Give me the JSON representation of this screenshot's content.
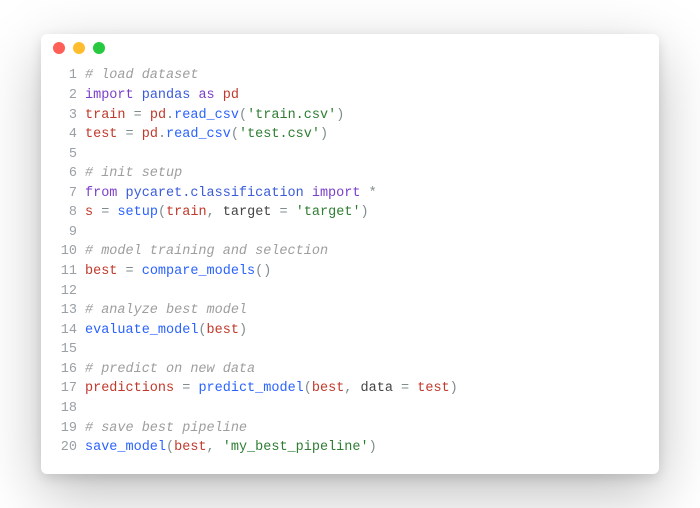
{
  "window": {
    "controls": [
      "close",
      "minimize",
      "zoom"
    ]
  },
  "code": {
    "lines": [
      {
        "n": "1",
        "tokens": [
          {
            "t": "# load dataset",
            "c": "comment"
          }
        ]
      },
      {
        "n": "2",
        "tokens": [
          {
            "t": "import",
            "c": "keyword"
          },
          {
            "t": " ",
            "c": "op"
          },
          {
            "t": "pandas",
            "c": "module"
          },
          {
            "t": " ",
            "c": "op"
          },
          {
            "t": "as",
            "c": "keyword"
          },
          {
            "t": " ",
            "c": "op"
          },
          {
            "t": "pd",
            "c": "ident"
          }
        ]
      },
      {
        "n": "3",
        "tokens": [
          {
            "t": "train",
            "c": "ident"
          },
          {
            "t": " ",
            "c": "op"
          },
          {
            "t": "=",
            "c": "op"
          },
          {
            "t": " ",
            "c": "op"
          },
          {
            "t": "pd",
            "c": "ident"
          },
          {
            "t": ".",
            "c": "op"
          },
          {
            "t": "read_csv",
            "c": "attr"
          },
          {
            "t": "(",
            "c": "op"
          },
          {
            "t": "'train.csv'",
            "c": "string"
          },
          {
            "t": ")",
            "c": "op"
          }
        ]
      },
      {
        "n": "4",
        "tokens": [
          {
            "t": "test",
            "c": "ident"
          },
          {
            "t": " ",
            "c": "op"
          },
          {
            "t": "=",
            "c": "op"
          },
          {
            "t": " ",
            "c": "op"
          },
          {
            "t": "pd",
            "c": "ident"
          },
          {
            "t": ".",
            "c": "op"
          },
          {
            "t": "read_csv",
            "c": "attr"
          },
          {
            "t": "(",
            "c": "op"
          },
          {
            "t": "'test.csv'",
            "c": "string"
          },
          {
            "t": ")",
            "c": "op"
          }
        ]
      },
      {
        "n": "5",
        "tokens": [
          {
            "t": "",
            "c": "op"
          }
        ]
      },
      {
        "n": "6",
        "tokens": [
          {
            "t": "# init setup",
            "c": "comment"
          }
        ]
      },
      {
        "n": "7",
        "tokens": [
          {
            "t": "from",
            "c": "keyword"
          },
          {
            "t": " ",
            "c": "op"
          },
          {
            "t": "pycaret.classification",
            "c": "module"
          },
          {
            "t": " ",
            "c": "op"
          },
          {
            "t": "import",
            "c": "keyword"
          },
          {
            "t": " ",
            "c": "op"
          },
          {
            "t": "*",
            "c": "op"
          }
        ]
      },
      {
        "n": "8",
        "tokens": [
          {
            "t": "s",
            "c": "ident"
          },
          {
            "t": " ",
            "c": "op"
          },
          {
            "t": "=",
            "c": "op"
          },
          {
            "t": " ",
            "c": "op"
          },
          {
            "t": "setup",
            "c": "attr"
          },
          {
            "t": "(",
            "c": "op"
          },
          {
            "t": "train",
            "c": "ident"
          },
          {
            "t": ",",
            "c": "op"
          },
          {
            "t": " ",
            "c": "op"
          },
          {
            "t": "target",
            "c": "kwarg"
          },
          {
            "t": " ",
            "c": "op"
          },
          {
            "t": "=",
            "c": "op"
          },
          {
            "t": " ",
            "c": "op"
          },
          {
            "t": "'target'",
            "c": "string"
          },
          {
            "t": ")",
            "c": "op"
          }
        ]
      },
      {
        "n": "9",
        "tokens": [
          {
            "t": "",
            "c": "op"
          }
        ]
      },
      {
        "n": "10",
        "tokens": [
          {
            "t": "# model training and selection",
            "c": "comment"
          }
        ]
      },
      {
        "n": "11",
        "tokens": [
          {
            "t": "best",
            "c": "ident"
          },
          {
            "t": " ",
            "c": "op"
          },
          {
            "t": "=",
            "c": "op"
          },
          {
            "t": " ",
            "c": "op"
          },
          {
            "t": "compare_models",
            "c": "attr"
          },
          {
            "t": "(",
            "c": "op"
          },
          {
            "t": ")",
            "c": "op"
          }
        ]
      },
      {
        "n": "12",
        "tokens": [
          {
            "t": "",
            "c": "op"
          }
        ]
      },
      {
        "n": "13",
        "tokens": [
          {
            "t": "# analyze best model",
            "c": "comment"
          }
        ]
      },
      {
        "n": "14",
        "tokens": [
          {
            "t": "evaluate_model",
            "c": "attr"
          },
          {
            "t": "(",
            "c": "op"
          },
          {
            "t": "best",
            "c": "ident"
          },
          {
            "t": ")",
            "c": "op"
          }
        ]
      },
      {
        "n": "15",
        "tokens": [
          {
            "t": "",
            "c": "op"
          }
        ]
      },
      {
        "n": "16",
        "tokens": [
          {
            "t": "# predict on new data",
            "c": "comment"
          }
        ]
      },
      {
        "n": "17",
        "tokens": [
          {
            "t": "predictions",
            "c": "ident"
          },
          {
            "t": " ",
            "c": "op"
          },
          {
            "t": "=",
            "c": "op"
          },
          {
            "t": " ",
            "c": "op"
          },
          {
            "t": "predict_model",
            "c": "attr"
          },
          {
            "t": "(",
            "c": "op"
          },
          {
            "t": "best",
            "c": "ident"
          },
          {
            "t": ",",
            "c": "op"
          },
          {
            "t": " ",
            "c": "op"
          },
          {
            "t": "data",
            "c": "kwarg"
          },
          {
            "t": " ",
            "c": "op"
          },
          {
            "t": "=",
            "c": "op"
          },
          {
            "t": " ",
            "c": "op"
          },
          {
            "t": "test",
            "c": "ident"
          },
          {
            "t": ")",
            "c": "op"
          }
        ]
      },
      {
        "n": "18",
        "tokens": [
          {
            "t": "",
            "c": "op"
          }
        ]
      },
      {
        "n": "19",
        "tokens": [
          {
            "t": "# save best pipeline",
            "c": "comment"
          }
        ]
      },
      {
        "n": "20",
        "tokens": [
          {
            "t": "save_model",
            "c": "attr"
          },
          {
            "t": "(",
            "c": "op"
          },
          {
            "t": "best",
            "c": "ident"
          },
          {
            "t": ",",
            "c": "op"
          },
          {
            "t": " ",
            "c": "op"
          },
          {
            "t": "'my_best_pipeline'",
            "c": "string"
          },
          {
            "t": ")",
            "c": "op"
          }
        ]
      }
    ]
  }
}
